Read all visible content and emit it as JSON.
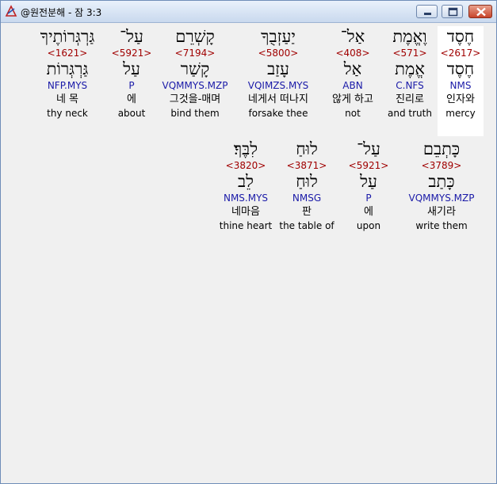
{
  "window": {
    "title": "@원전분해 - 잠 3:3"
  },
  "icons": {
    "app": "app-logo-icon",
    "minimize": "minimize-icon",
    "maximize": "maximize-icon",
    "close": "close-icon"
  },
  "colors": {
    "strong_number": "#a00000",
    "morphology": "#1a1aa8",
    "selected_background": "#ffffff"
  },
  "rows": [
    {
      "words": [
        {
          "heb": "חֶסֶד",
          "strong": "<2617>",
          "lemma": "חֶסֶד",
          "morph": "NMS",
          "kor": "인자와",
          "eng": "mercy",
          "selected": true
        },
        {
          "heb": "וֶאֱמֶת",
          "strong": "<571>",
          "lemma": "אֱמֶת",
          "morph": "C.NFS",
          "kor": "진리로",
          "eng": "and truth",
          "selected": false
        },
        {
          "heb": "אַל־",
          "strong": "<408>",
          "lemma": "אַל",
          "morph": "ABN",
          "kor": "않게 하고",
          "eng": "not",
          "selected": false
        },
        {
          "heb": "יַעַזְבֻךָ",
          "strong": "<5800>",
          "lemma": "עָזַב",
          "morph": "VQIMZS.MYS",
          "kor": "네게서 떠나지",
          "eng": "forsake thee",
          "selected": false
        },
        {
          "heb": "קָשְׁרֵם",
          "strong": "<7194>",
          "lemma": "קָשַׁר",
          "morph": "VQMMYS.MZP",
          "kor": "그것을-매며",
          "eng": "bind them",
          "selected": false
        },
        {
          "heb": "עַל־",
          "strong": "<5921>",
          "lemma": "עַל",
          "morph": "P",
          "kor": "에",
          "eng": "about",
          "selected": false
        },
        {
          "heb": "גַּרְגְּרוֹתֶיךָ",
          "strong": "<1621>",
          "lemma": "גַּרְגְּרוֹת",
          "morph": "NFP.MYS",
          "kor": "네 목",
          "eng": "thy neck",
          "selected": false
        }
      ]
    },
    {
      "words": [
        {
          "heb": "כָּתְבֵם",
          "strong": "<3789>",
          "lemma": "כָּתַב",
          "morph": "VQMMYS.MZP",
          "kor": "새기라",
          "eng": "write them",
          "selected": false
        },
        {
          "heb": "עַל־",
          "strong": "<5921>",
          "lemma": "עַל",
          "morph": "P",
          "kor": "에",
          "eng": "upon",
          "selected": false
        },
        {
          "heb": "לוּחַ",
          "strong": "<3871>",
          "lemma": "לוּחַ",
          "morph": "NMSG",
          "kor": "판",
          "eng": "the table of",
          "selected": false
        },
        {
          "heb": "לִבֶּךָ׃",
          "strong": "<3820>",
          "lemma": "לֵב",
          "morph": "NMS.MYS",
          "kor": "네마음",
          "eng": "thine heart",
          "selected": false
        }
      ]
    }
  ]
}
